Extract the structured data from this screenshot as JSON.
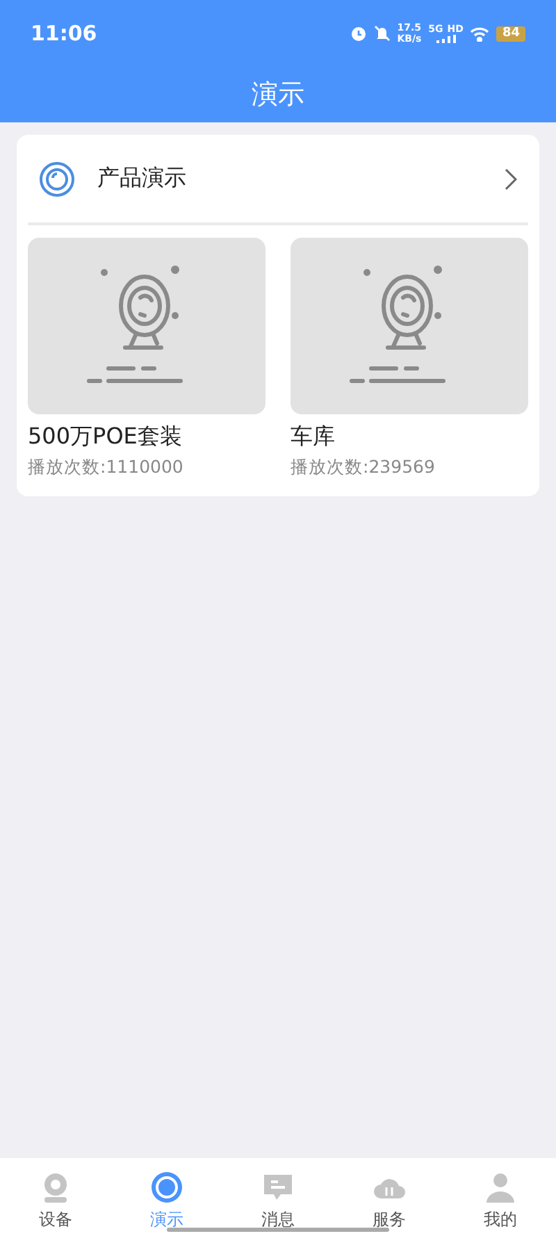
{
  "status_bar": {
    "time": "11:06",
    "speed_value": "17.5",
    "speed_unit": "KB/s",
    "network": "5G",
    "network_extra": "HD",
    "battery": "84"
  },
  "header": {
    "title": "演示"
  },
  "section": {
    "title": "产品演示",
    "items": [
      {
        "title": "500万POE套装",
        "plays": "播放次数:1110000"
      },
      {
        "title": "车库",
        "plays": "播放次数:239569"
      }
    ]
  },
  "tab_bar": [
    {
      "kind": "device",
      "label": "设备",
      "selected": false
    },
    {
      "kind": "demo",
      "label": "演示",
      "selected": true
    },
    {
      "kind": "message",
      "label": "消息",
      "selected": false
    },
    {
      "kind": "service",
      "label": "服务",
      "selected": false
    },
    {
      "kind": "profile",
      "label": "我的",
      "selected": false
    }
  ]
}
